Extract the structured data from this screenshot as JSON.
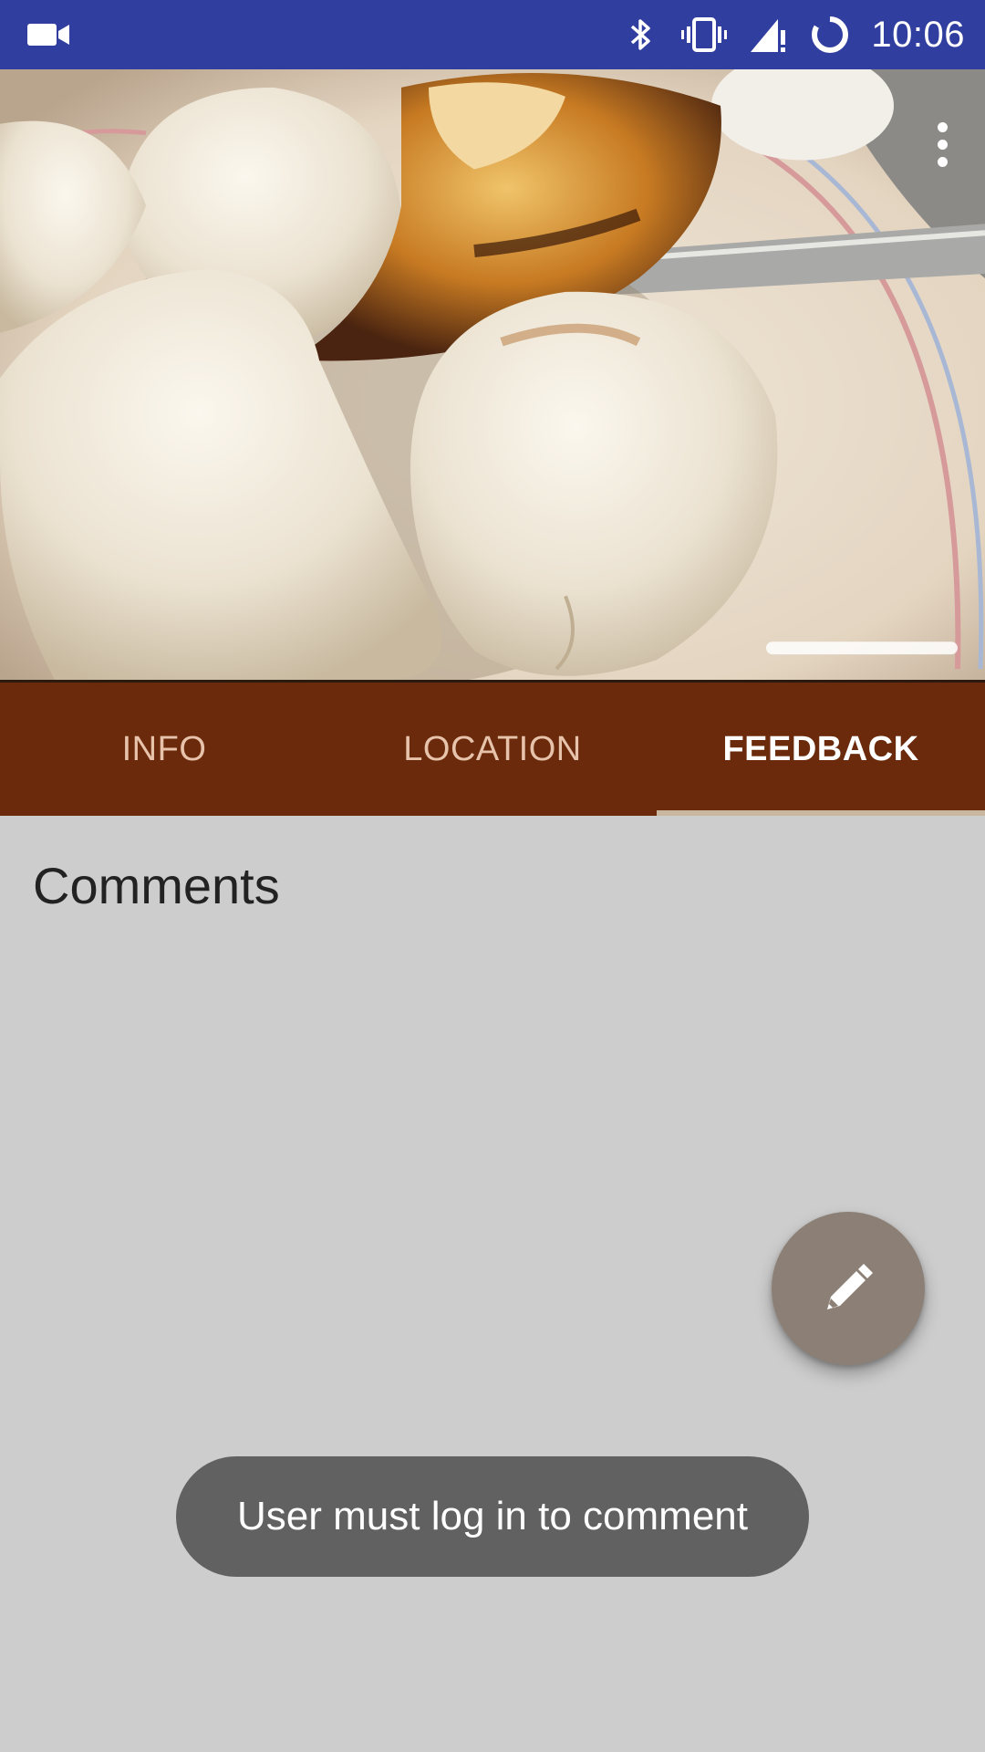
{
  "status_bar": {
    "time": "10:06",
    "left_icon": "video-camera-icon",
    "right_icons": [
      "bluetooth-icon",
      "vibrate-icon",
      "signal-alert-icon",
      "sync-icon"
    ],
    "background_color": "#303f9f"
  },
  "hero": {
    "image": "photo of white dumplings with caramelized sauce on a plate with a spoon",
    "menu_icon": "more-vert-icon"
  },
  "tabs": {
    "items": [
      {
        "label": "INFO",
        "active": false
      },
      {
        "label": "LOCATION",
        "active": false
      },
      {
        "label": "FEEDBACK",
        "active": true
      }
    ],
    "background_color": "#6a2a0b",
    "indicator_color": "#c9b69f"
  },
  "main": {
    "section_title": "Comments"
  },
  "fab": {
    "icon": "pencil-icon",
    "color": "#8c8076"
  },
  "toast": {
    "message": "User must log in to comment"
  }
}
